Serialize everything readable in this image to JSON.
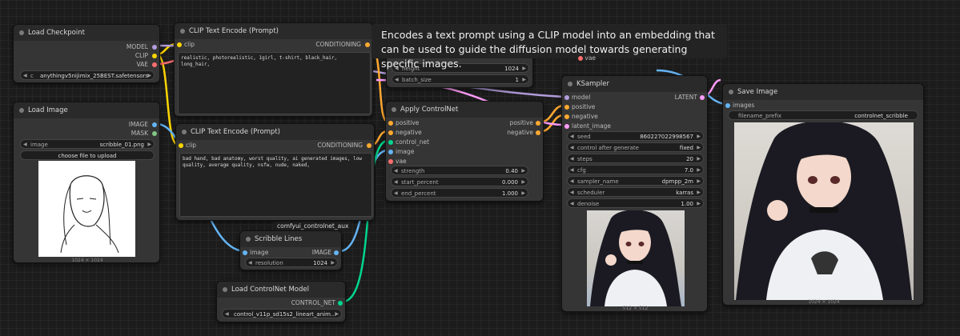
{
  "tooltip": "Encodes a text prompt using a CLIP model into an embedding that can be used to guide the diffusion model towards generating specific images.",
  "load_checkpoint": {
    "title": "Load Checkpoint",
    "outputs": [
      "MODEL",
      "CLIP",
      "VAE"
    ],
    "ckpt_name": "anythingv5nijimix_25BEST.safetensors",
    "ckpt_prefix": "c"
  },
  "load_image": {
    "title": "Load Image",
    "outputs": [
      "IMAGE",
      "MASK"
    ],
    "image_label": "image",
    "image_value": "scribble_01.png",
    "upload_label": "choose file to upload",
    "caption": "1024 × 1024"
  },
  "clip_pos": {
    "title": "CLIP Text Encode (Prompt)",
    "input": "clip",
    "output": "CONDITIONING",
    "text": "realistic, photorealistic, 1girl, t-shirt, black_hair, long_hair,"
  },
  "clip_neg": {
    "title": "CLIP Text Encode (Prompt)",
    "input": "clip",
    "output": "CONDITIONING",
    "text": "bad hand, bad anatomy, worst quality, ai generated images, low quality, average quality, nsfw, nude, naked,",
    "badge": "comfyui_controlnet_aux"
  },
  "latent": {
    "vae_label": "vae",
    "height_label": "height",
    "height_value": "1024",
    "batch_label": "batch_size",
    "batch_value": "1"
  },
  "apply_controlnet": {
    "title": "Apply ControlNet",
    "inputs": [
      "positive",
      "negative",
      "control_net",
      "image",
      "vae"
    ],
    "outputs": [
      "positive",
      "negative"
    ],
    "widgets": [
      {
        "label": "strength",
        "value": "0.40"
      },
      {
        "label": "start_percent",
        "value": "0.000"
      },
      {
        "label": "end_percent",
        "value": "1.000"
      }
    ]
  },
  "scribble": {
    "title": "Scribble Lines",
    "input": "image",
    "output": "IMAGE",
    "res_label": "resolution",
    "res_value": "1024"
  },
  "load_controlnet": {
    "title": "Load ControlNet Model",
    "output": "CONTROL_NET",
    "value": "control_v11p_sd15s2_lineart_anim..."
  },
  "ksampler": {
    "title": "KSampler",
    "inputs": [
      "model",
      "positive",
      "negative",
      "latent_image"
    ],
    "output": "LATENT",
    "widgets": [
      {
        "label": "seed",
        "value": "860227022998567"
      },
      {
        "label": "control after generate",
        "value": "fixed"
      },
      {
        "label": "steps",
        "value": "20"
      },
      {
        "label": "cfg",
        "value": "7.0"
      },
      {
        "label": "sampler_name",
        "value": "dpmpp_2m"
      },
      {
        "label": "scheduler",
        "value": "karras"
      },
      {
        "label": "denoise",
        "value": "1.00"
      }
    ],
    "caption": "512 × 512"
  },
  "save_image": {
    "title": "Save Image",
    "input": "images",
    "prefix_label": "filename_prefix",
    "prefix_value": "controlnet_scribble",
    "caption": "1024 × 1024"
  },
  "colors": {
    "model": "#b39ddb",
    "clip": "#ffd500",
    "vae": "#ff6e6e",
    "conditioning": "#ffa931",
    "image": "#64b5f6",
    "latent": "#ff9cf9",
    "control_net": "#00d78d"
  }
}
